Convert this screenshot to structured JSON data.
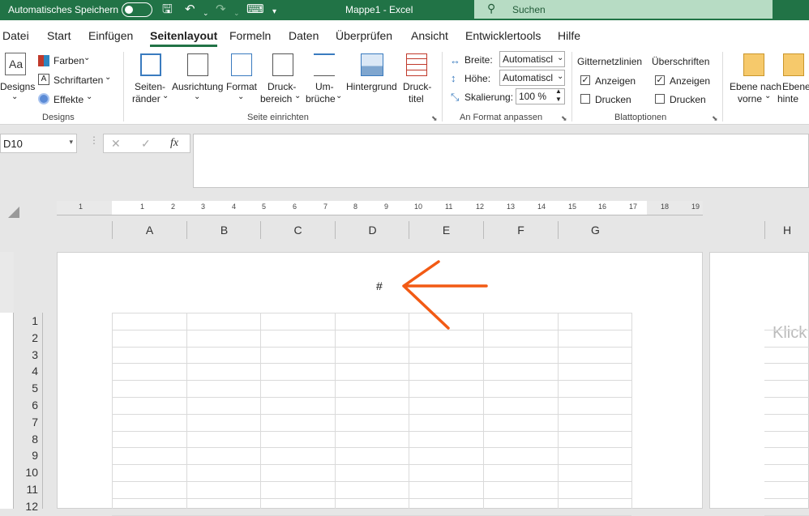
{
  "titlebar": {
    "autosave": "Automatisches Speichern",
    "doc_title": "Mappe1  -  Excel",
    "search_placeholder": "Suchen"
  },
  "tabs": [
    "Datei",
    "Start",
    "Einfügen",
    "Seitenlayout",
    "Formeln",
    "Daten",
    "Überprüfen",
    "Ansicht",
    "Entwicklertools",
    "Hilfe"
  ],
  "active_tab": "Seitenlayout",
  "ribbon": {
    "designs": {
      "label": "Designs",
      "farben": "Farben",
      "schriftarten": "Schriftarten",
      "effekte": "Effekte",
      "group": "Designs"
    },
    "seite": {
      "seitenraender_1": "Seiten-",
      "seitenraender_2": "ränder",
      "ausrichtung": "Ausrichtung",
      "format": "Format",
      "druckbereich_1": "Druck-",
      "druckbereich_2": "bereich",
      "umbrueche_1": "Um-",
      "umbrueche_2": "brüche",
      "hintergrund": "Hintergrund",
      "drucktitel_1": "Druck-",
      "drucktitel_2": "titel",
      "group": "Seite einrichten"
    },
    "anpassen": {
      "breite_label": "Breite:",
      "breite_value": "Automatiscl",
      "hoehe_label": "Höhe:",
      "hoehe_value": "Automatiscl",
      "skalierung_label": "Skalierung:",
      "skalierung_value": "100 %",
      "group": "An Format anpassen"
    },
    "blatt": {
      "gitter": "Gitternetzlinien",
      "ueberschriften": "Überschriften",
      "anzeigen1": "Anzeigen",
      "drucken1": "Drucken",
      "anzeigen2": "Anzeigen",
      "drucken2": "Drucken",
      "group": "Blattoptionen"
    },
    "anordnen": {
      "ebene_vorne_1": "Ebene nach",
      "ebene_vorne_2": "vorne",
      "ebene_hinten_1": "Ebene",
      "ebene_hinten_2": "hinte"
    }
  },
  "formula": {
    "namebox": "D10",
    "cancel": "✕",
    "enter": "✓",
    "fx": "fx",
    "value": ""
  },
  "ruler_ticks": [
    "1",
    "1",
    "2",
    "3",
    "4",
    "5",
    "6",
    "7",
    "8",
    "9",
    "10",
    "11",
    "12",
    "13",
    "14",
    "15",
    "16",
    "17",
    "18",
    "19"
  ],
  "columns": [
    "A",
    "B",
    "C",
    "D",
    "E",
    "F",
    "G"
  ],
  "column_h": "H",
  "rows": [
    "1",
    "2",
    "3",
    "4",
    "5",
    "6",
    "7",
    "8",
    "9",
    "10",
    "11",
    "12"
  ],
  "header_text": "#",
  "page2_placeholder": "Klick",
  "annotation_color": "#f25a14"
}
